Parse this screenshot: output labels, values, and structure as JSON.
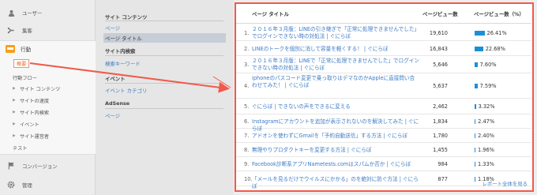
{
  "nav": {
    "users": "ユーザー",
    "acquisition": "集客",
    "behavior": "行動",
    "overview": "概要",
    "behavior_flow": "行動フロー",
    "site_content": "サイト コンテンツ",
    "site_speed": "サイトの速度",
    "site_search": "サイト内検索",
    "events": "イベント",
    "publisher": "サイト運営者",
    "experiments": "テスト",
    "conversions": "コンバージョン",
    "admin": "管理"
  },
  "reports": {
    "site_content_heading": "サイト コンテンツ",
    "page": "ページ",
    "page_title": "ページ タイトル",
    "site_search_heading": "サイト内検索",
    "search_term": "検索キーワード",
    "event_heading": "イベント",
    "event_category": "イベント カテゴリ",
    "adsense_heading": "AdSense",
    "adsense_page": "ページ"
  },
  "table": {
    "col_title": "ページ タイトル",
    "col_views": "ページビュー数",
    "col_pct": "ページビュー数（%）",
    "rows": [
      {
        "num": "1.",
        "title": "２０１６年３月版：LINEの引き継ぎで「正常に処理できませんでした」でログインできない時の対処法 | ぐにらぼ",
        "views": "19,610",
        "pct": "26.41%",
        "share": 26.41
      },
      {
        "num": "2.",
        "title": "LINEのトークを個別に消して容量を軽くする！ | ぐにらぼ",
        "views": "16,843",
        "pct": "22.68%",
        "share": 22.68
      },
      {
        "num": "3.",
        "title": "２０１６年３月版：LINEで「正常に処理できませんでした」でログインできない時の対処法 | ぐにらぼ",
        "views": "5,646",
        "pct": "7.60%",
        "share": 7.6
      },
      {
        "num": "4.",
        "title": "iphoneのパスコード変更で乗っ取りはデマなのかAppleに直接問い合わせてみた！ | ぐにらぼ",
        "views": "5,637",
        "pct": "7.59%",
        "share": 7.59
      },
      {
        "num": "5.",
        "title": "ぐにらぼ | できないの声をできるに変える",
        "views": "2,462",
        "pct": "3.32%",
        "share": 3.32
      },
      {
        "num": "6.",
        "title": "Instagramにアカウントを追加が表示されないのを解決してみた | ぐにらぼ",
        "views": "1,834",
        "pct": "2.47%",
        "share": 2.47
      },
      {
        "num": "7.",
        "title": "アドオンを使わずにGmailを「予約自動送信」する方法 | ぐにらぼ",
        "views": "1,780",
        "pct": "2.40%",
        "share": 2.4
      },
      {
        "num": "8.",
        "title": "無理やりプロダクトキーを変更する方法 | ぐにらぼ",
        "views": "1,455",
        "pct": "1.96%",
        "share": 1.96
      },
      {
        "num": "9.",
        "title": "Facebook診断系アプリNametests.comはスパムか否か | ぐにらぼ",
        "views": "984",
        "pct": "1.33%",
        "share": 1.33
      },
      {
        "num": "10.",
        "title": "「メールを見るだけでウイルスにかかる」のを絶対に防ぐ方法 | ぐにらぼ",
        "views": "877",
        "pct": "1.18%",
        "share": 1.18
      }
    ],
    "report_link": "レポート全体を見る"
  },
  "colors": {
    "highlight": "#f05a4b",
    "accent": "#e8711f",
    "bar": "#1c8fd4",
    "link": "#3b7ac4"
  }
}
